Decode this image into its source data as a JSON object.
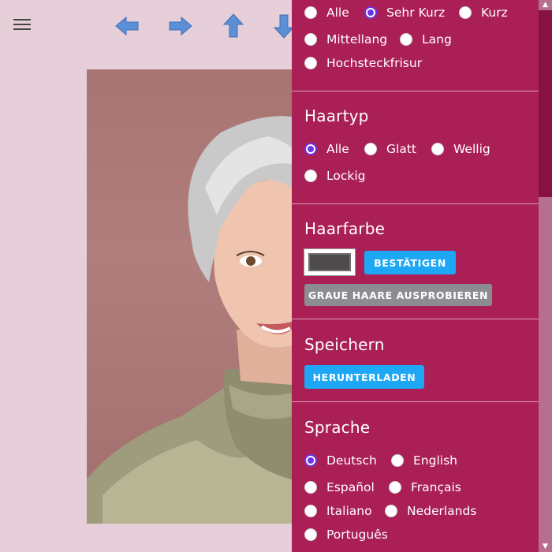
{
  "hair_length": {
    "options": [
      "Alle",
      "Sehr Kurz",
      "Kurz",
      "Mittellang",
      "Lang",
      "Hochsteckfrisur"
    ],
    "selected": "Sehr Kurz"
  },
  "hair_type": {
    "title": "Haartyp",
    "options": [
      "Alle",
      "Glatt",
      "Wellig",
      "Lockig"
    ],
    "selected": "Alle"
  },
  "hair_color": {
    "title": "Haarfarbe",
    "swatch_color": "#4f4b4d",
    "confirm_label": "BESTÄTIGEN",
    "gray_label": "GRAUE HAARE AUSPROBIEREN"
  },
  "save": {
    "title": "Speichern",
    "download_label": "HERUNTERLADEN"
  },
  "language": {
    "title": "Sprache",
    "options": [
      "Deutsch",
      "English",
      "Español",
      "Français",
      "Italiano",
      "Nederlands",
      "Português"
    ],
    "selected": "Deutsch"
  },
  "colors": {
    "panel": "#aa1f56",
    "accent_radio": "#6a35e6",
    "button_blue": "#1ea7f5",
    "button_grey": "#8b8d90",
    "background": "#e6cfd9"
  },
  "icons": [
    "menu-icon",
    "arrow-left-icon",
    "arrow-right-icon",
    "arrow-up-icon",
    "arrow-down-icon"
  ]
}
